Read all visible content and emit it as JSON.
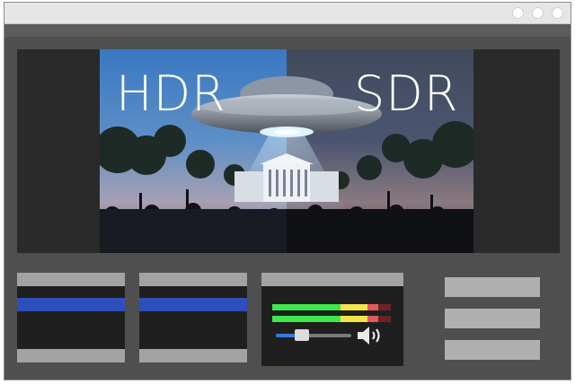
{
  "window": {
    "controls": [
      "window-control-1",
      "window-control-2",
      "window-control-3"
    ]
  },
  "viewer": {
    "left_label": "HDR",
    "right_label": "SDR",
    "scene_icons": [
      "ufo-icon",
      "white-house-icon",
      "crowd-icon"
    ]
  },
  "panels": {
    "clip_panel_1": {
      "header": "",
      "selected_item": "",
      "footer": ""
    },
    "clip_panel_2": {
      "header": "",
      "selected_item": "",
      "footer": ""
    },
    "audio_panel": {
      "header": "",
      "meter_channels": 2,
      "meter_levels": [
        0.98,
        0.98
      ],
      "volume": 0.34,
      "speaker_icon": "speaker-volume-icon"
    }
  },
  "side_buttons": [
    "",
    "",
    ""
  ],
  "colors": {
    "selection": "#2d4fbc",
    "meter_green": "#3fe84b",
    "meter_yellow": "#f4e34b",
    "meter_red": "#e05b5b",
    "meter_off": "#6b2424",
    "slider_accent": "#2f7de1"
  }
}
